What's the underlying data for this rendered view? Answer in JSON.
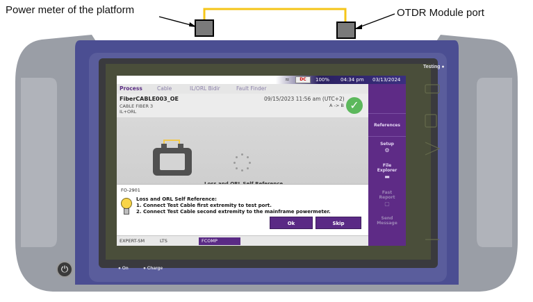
{
  "annotations": {
    "left_label": "Power meter of the platform",
    "right_label": "OTDR Module port"
  },
  "colors": {
    "cable": "#f5c518",
    "accent_purple": "#5a2a85",
    "success_green": "#5cb85c"
  },
  "device": {
    "status_label": "Testing",
    "led_on": "On",
    "led_charge": "Charge",
    "power_icon": "power-icon"
  },
  "screen": {
    "statusbar": {
      "battery": "100%",
      "time": "04:34 pm",
      "date": "03/13/2024"
    },
    "tabs": [
      "Process",
      "Cable",
      "IL/ORL Bidir",
      "Fault Finder"
    ],
    "active_tab": "Process",
    "info": {
      "file_name": "FiberCABLE003_OE",
      "cable_id": "CABLE FIBER 3",
      "measurement": "IL+ORL",
      "date": "09/15/2023 11:56 am (UTC+2)",
      "direction": "A -> B"
    },
    "test_label": "Loss and ORL Self Reference",
    "dialog": {
      "code": "FO-2901",
      "title": "Loss and ORL Self Reference:",
      "step1": "1. Connect Test Cable first extremity to test port.",
      "step2": "2. Connect Test Cable second extremity to the mainframe powermeter.",
      "ok": "Ok",
      "skip": "Skip"
    },
    "footer": {
      "expert": "EXPERT-SM",
      "lts": "LTS",
      "fcomp": "FCOMP"
    },
    "sidebar": {
      "references": "References",
      "setup": "Setup",
      "file_explorer_1": "File",
      "file_explorer_2": "Explorer",
      "fast_report_1": "Fast",
      "fast_report_2": "Report",
      "send_message_1": "Send",
      "send_message_2": "Message"
    }
  }
}
